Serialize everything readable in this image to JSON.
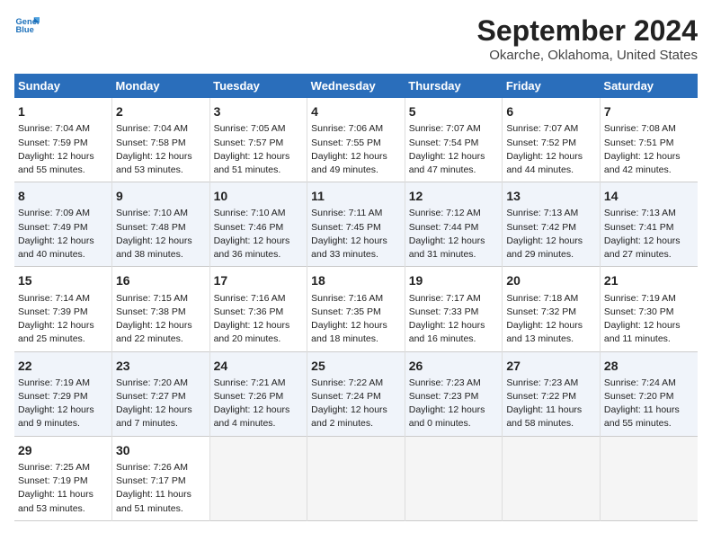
{
  "app": {
    "name_line1": "General",
    "name_line2": "Blue"
  },
  "header": {
    "title": "September 2024",
    "subtitle": "Okarche, Oklahoma, United States"
  },
  "columns": [
    "Sunday",
    "Monday",
    "Tuesday",
    "Wednesday",
    "Thursday",
    "Friday",
    "Saturday"
  ],
  "weeks": [
    [
      {
        "day": "1",
        "sunrise": "Sunrise: 7:04 AM",
        "sunset": "Sunset: 7:59 PM",
        "daylight": "Daylight: 12 hours and 55 minutes."
      },
      {
        "day": "2",
        "sunrise": "Sunrise: 7:04 AM",
        "sunset": "Sunset: 7:58 PM",
        "daylight": "Daylight: 12 hours and 53 minutes."
      },
      {
        "day": "3",
        "sunrise": "Sunrise: 7:05 AM",
        "sunset": "Sunset: 7:57 PM",
        "daylight": "Daylight: 12 hours and 51 minutes."
      },
      {
        "day": "4",
        "sunrise": "Sunrise: 7:06 AM",
        "sunset": "Sunset: 7:55 PM",
        "daylight": "Daylight: 12 hours and 49 minutes."
      },
      {
        "day": "5",
        "sunrise": "Sunrise: 7:07 AM",
        "sunset": "Sunset: 7:54 PM",
        "daylight": "Daylight: 12 hours and 47 minutes."
      },
      {
        "day": "6",
        "sunrise": "Sunrise: 7:07 AM",
        "sunset": "Sunset: 7:52 PM",
        "daylight": "Daylight: 12 hours and 44 minutes."
      },
      {
        "day": "7",
        "sunrise": "Sunrise: 7:08 AM",
        "sunset": "Sunset: 7:51 PM",
        "daylight": "Daylight: 12 hours and 42 minutes."
      }
    ],
    [
      {
        "day": "8",
        "sunrise": "Sunrise: 7:09 AM",
        "sunset": "Sunset: 7:49 PM",
        "daylight": "Daylight: 12 hours and 40 minutes."
      },
      {
        "day": "9",
        "sunrise": "Sunrise: 7:10 AM",
        "sunset": "Sunset: 7:48 PM",
        "daylight": "Daylight: 12 hours and 38 minutes."
      },
      {
        "day": "10",
        "sunrise": "Sunrise: 7:10 AM",
        "sunset": "Sunset: 7:46 PM",
        "daylight": "Daylight: 12 hours and 36 minutes."
      },
      {
        "day": "11",
        "sunrise": "Sunrise: 7:11 AM",
        "sunset": "Sunset: 7:45 PM",
        "daylight": "Daylight: 12 hours and 33 minutes."
      },
      {
        "day": "12",
        "sunrise": "Sunrise: 7:12 AM",
        "sunset": "Sunset: 7:44 PM",
        "daylight": "Daylight: 12 hours and 31 minutes."
      },
      {
        "day": "13",
        "sunrise": "Sunrise: 7:13 AM",
        "sunset": "Sunset: 7:42 PM",
        "daylight": "Daylight: 12 hours and 29 minutes."
      },
      {
        "day": "14",
        "sunrise": "Sunrise: 7:13 AM",
        "sunset": "Sunset: 7:41 PM",
        "daylight": "Daylight: 12 hours and 27 minutes."
      }
    ],
    [
      {
        "day": "15",
        "sunrise": "Sunrise: 7:14 AM",
        "sunset": "Sunset: 7:39 PM",
        "daylight": "Daylight: 12 hours and 25 minutes."
      },
      {
        "day": "16",
        "sunrise": "Sunrise: 7:15 AM",
        "sunset": "Sunset: 7:38 PM",
        "daylight": "Daylight: 12 hours and 22 minutes."
      },
      {
        "day": "17",
        "sunrise": "Sunrise: 7:16 AM",
        "sunset": "Sunset: 7:36 PM",
        "daylight": "Daylight: 12 hours and 20 minutes."
      },
      {
        "day": "18",
        "sunrise": "Sunrise: 7:16 AM",
        "sunset": "Sunset: 7:35 PM",
        "daylight": "Daylight: 12 hours and 18 minutes."
      },
      {
        "day": "19",
        "sunrise": "Sunrise: 7:17 AM",
        "sunset": "Sunset: 7:33 PM",
        "daylight": "Daylight: 12 hours and 16 minutes."
      },
      {
        "day": "20",
        "sunrise": "Sunrise: 7:18 AM",
        "sunset": "Sunset: 7:32 PM",
        "daylight": "Daylight: 12 hours and 13 minutes."
      },
      {
        "day": "21",
        "sunrise": "Sunrise: 7:19 AM",
        "sunset": "Sunset: 7:30 PM",
        "daylight": "Daylight: 12 hours and 11 minutes."
      }
    ],
    [
      {
        "day": "22",
        "sunrise": "Sunrise: 7:19 AM",
        "sunset": "Sunset: 7:29 PM",
        "daylight": "Daylight: 12 hours and 9 minutes."
      },
      {
        "day": "23",
        "sunrise": "Sunrise: 7:20 AM",
        "sunset": "Sunset: 7:27 PM",
        "daylight": "Daylight: 12 hours and 7 minutes."
      },
      {
        "day": "24",
        "sunrise": "Sunrise: 7:21 AM",
        "sunset": "Sunset: 7:26 PM",
        "daylight": "Daylight: 12 hours and 4 minutes."
      },
      {
        "day": "25",
        "sunrise": "Sunrise: 7:22 AM",
        "sunset": "Sunset: 7:24 PM",
        "daylight": "Daylight: 12 hours and 2 minutes."
      },
      {
        "day": "26",
        "sunrise": "Sunrise: 7:23 AM",
        "sunset": "Sunset: 7:23 PM",
        "daylight": "Daylight: 12 hours and 0 minutes."
      },
      {
        "day": "27",
        "sunrise": "Sunrise: 7:23 AM",
        "sunset": "Sunset: 7:22 PM",
        "daylight": "Daylight: 11 hours and 58 minutes."
      },
      {
        "day": "28",
        "sunrise": "Sunrise: 7:24 AM",
        "sunset": "Sunset: 7:20 PM",
        "daylight": "Daylight: 11 hours and 55 minutes."
      }
    ],
    [
      {
        "day": "29",
        "sunrise": "Sunrise: 7:25 AM",
        "sunset": "Sunset: 7:19 PM",
        "daylight": "Daylight: 11 hours and 53 minutes."
      },
      {
        "day": "30",
        "sunrise": "Sunrise: 7:26 AM",
        "sunset": "Sunset: 7:17 PM",
        "daylight": "Daylight: 11 hours and 51 minutes."
      },
      null,
      null,
      null,
      null,
      null
    ]
  ]
}
